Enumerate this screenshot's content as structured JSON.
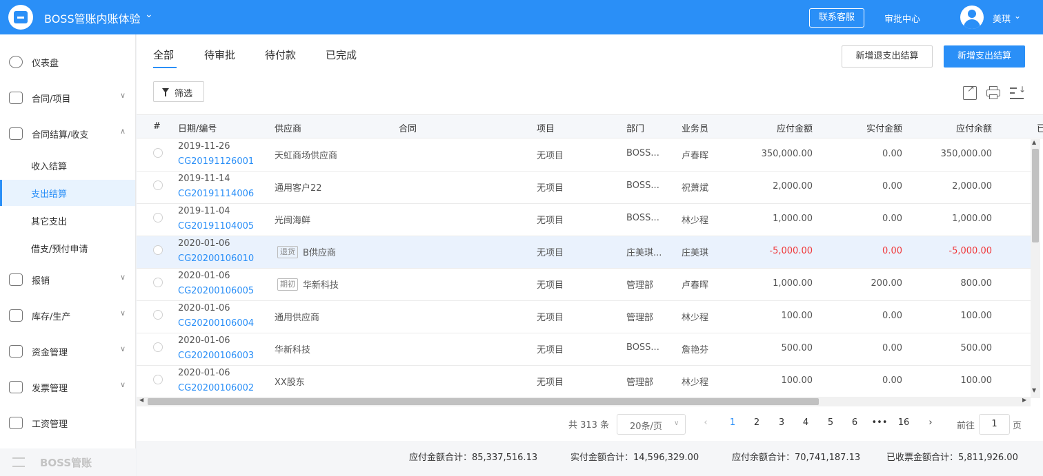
{
  "header": {
    "app_title": "BOSS管账内账体验",
    "service_label": "联系客服",
    "approval_label": "审批中心",
    "username": "美琪"
  },
  "sidebar": {
    "items": [
      {
        "label": "仪表盘"
      },
      {
        "label": "合同/项目"
      },
      {
        "label": "合同结算/收支"
      },
      {
        "label": "报销"
      },
      {
        "label": "库存/生产"
      },
      {
        "label": "资金管理"
      },
      {
        "label": "发票管理"
      },
      {
        "label": "工资管理"
      }
    ],
    "sub_items": [
      {
        "label": "收入结算"
      },
      {
        "label": "支出结算"
      },
      {
        "label": "其它支出"
      },
      {
        "label": "借支/预付申请"
      }
    ],
    "brand": "BOSS管账"
  },
  "main": {
    "tabs": [
      {
        "label": "全部"
      },
      {
        "label": "待审批"
      },
      {
        "label": "待付款"
      },
      {
        "label": "已完成"
      }
    ],
    "btn_refund": "新增退支出结算",
    "btn_new": "新增支出结算",
    "filter_label": "筛选"
  },
  "table": {
    "headers": [
      "#",
      "日期/编号",
      "供应商",
      "合同",
      "项目",
      "部门",
      "业务员",
      "应付金额",
      "实付金额",
      "应付余额",
      "已"
    ],
    "rows": [
      {
        "date": "2019-11-26",
        "code": "CG20191126001",
        "tag": "",
        "supplier": "天虹商场供应商",
        "project": "无项目",
        "dept": "BOSS...",
        "staff": "卢春晖",
        "payable": "350,000.00",
        "paid": "0.00",
        "balance": "350,000.00"
      },
      {
        "date": "2019-11-14",
        "code": "CG20191114006",
        "tag": "",
        "supplier": "通用客户22",
        "project": "无项目",
        "dept": "BOSS...",
        "staff": "祝萧斌",
        "payable": "2,000.00",
        "paid": "0.00",
        "balance": "2,000.00"
      },
      {
        "date": "2019-11-04",
        "code": "CG20191104005",
        "tag": "",
        "supplier": "光闽海鲜",
        "project": "无项目",
        "dept": "BOSS...",
        "staff": "林少程",
        "payable": "1,000.00",
        "paid": "0.00",
        "balance": "1,000.00"
      },
      {
        "date": "2020-01-06",
        "code": "CG20200106010",
        "tag": "退货",
        "supplier": "B供应商",
        "project": "无项目",
        "dept": "庄美琪...",
        "staff": "庄美琪",
        "payable": "-5,000.00",
        "paid": "0.00",
        "balance": "-5,000.00"
      },
      {
        "date": "2020-01-06",
        "code": "CG20200106005",
        "tag": "期初",
        "supplier": "华新科技",
        "project": "无项目",
        "dept": "管理部",
        "staff": "卢春晖",
        "payable": "1,000.00",
        "paid": "200.00",
        "balance": "800.00"
      },
      {
        "date": "2020-01-06",
        "code": "CG20200106004",
        "tag": "",
        "supplier": "通用供应商",
        "project": "无项目",
        "dept": "管理部",
        "staff": "林少程",
        "payable": "100.00",
        "paid": "0.00",
        "balance": "100.00"
      },
      {
        "date": "2020-01-06",
        "code": "CG20200106003",
        "tag": "",
        "supplier": "华新科技",
        "project": "无项目",
        "dept": "BOSS...",
        "staff": "詹艳芬",
        "payable": "500.00",
        "paid": "0.00",
        "balance": "500.00"
      },
      {
        "date": "2020-01-06",
        "code": "CG20200106002",
        "tag": "",
        "supplier": "XX股东",
        "project": "无项目",
        "dept": "管理部",
        "staff": "林少程",
        "payable": "100.00",
        "paid": "0.00",
        "balance": "100.00"
      }
    ],
    "negative_color": "#f0383b",
    "highlight_row": 3
  },
  "pagination": {
    "total": "共 313 条",
    "page_size": "20条/页",
    "pages": [
      "1",
      "2",
      "3",
      "4",
      "5",
      "6",
      "•••",
      "16"
    ],
    "current": "1",
    "goto_label": "前往",
    "goto_value": "1",
    "goto_unit": "页"
  },
  "summary": {
    "payable_total": "应付金额合计：85,337,516.13",
    "paid_total": "实付金额合计：14,596,329.00",
    "balance_total": "应付余额合计：70,741,187.13",
    "invoiced_total": "已收票金额合计：5,811,926.00"
  },
  "colors": {
    "primary": "#2a8ff7",
    "negative": "#f0383b"
  }
}
